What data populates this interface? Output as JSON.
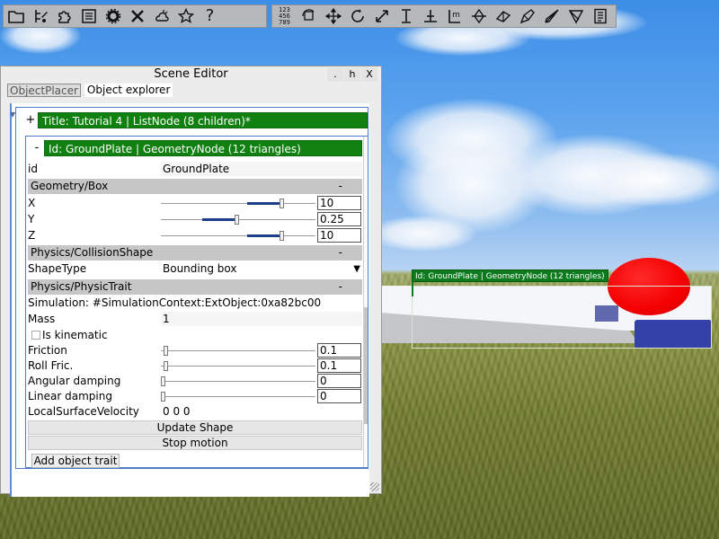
{
  "editor": {
    "title": "Scene Editor",
    "window_buttons": {
      "close_label": ".",
      "hide_label": "h",
      "exit_label": "X"
    },
    "tabs": [
      {
        "label": "ObjectPlacer"
      },
      {
        "label": "Object explorer"
      }
    ],
    "root_node": {
      "toggle": "+",
      "label": "Title: Tutorial 4 | ListNode (8 children)*"
    },
    "child_node": {
      "toggle": "-",
      "label": "Id: GroundPlate | GeometryNode (12 triangles)"
    },
    "id_row": {
      "label": "id",
      "value": "GroundPlate"
    },
    "geometry": {
      "title": "Geometry/Box",
      "collapse": "-",
      "x": {
        "label": "X",
        "value": "10",
        "level": 0.79
      },
      "y": {
        "label": "Y",
        "value": "0.25",
        "level": 0.49
      },
      "z": {
        "label": "Z",
        "value": "10",
        "level": 0.79
      }
    },
    "collision": {
      "title": "Physics/CollisionShape",
      "collapse": "-",
      "shape_label": "ShapeType",
      "shape_value": "Bounding box",
      "dropdown_glyph": "▼"
    },
    "physic_trait": {
      "title": "Physics/PhysicTrait",
      "collapse": "-",
      "simulation": "Simulation: #SimulationContext:ExtObject:0xa82bc00",
      "mass_label": "Mass",
      "mass_value": "1",
      "kinematic_label": "Is kinematic",
      "friction": {
        "label": "Friction",
        "value": "0.1",
        "level": 0.02
      },
      "roll_friction": {
        "label": "Roll Fric.",
        "value": "0.1",
        "level": 0.02
      },
      "angular_damping": {
        "label": "Angular damping",
        "value": "0",
        "level": 0.0
      },
      "linear_damping": {
        "label": "Linear damping",
        "value": "0",
        "level": 0.0
      },
      "velocity_label": "LocalSurfaceVelocity",
      "velocity_value": "0 0 0",
      "update_shape_label": "Update Shape",
      "stop_motion_label": "Stop motion"
    },
    "add_trait_label": "Add object trait"
  },
  "viewport": {
    "selection_label": "Id: GroundPlate | GeometryNode (12 triangles)"
  },
  "toolbar_left": {
    "icons": [
      "folder-icon",
      "tree-edit-icon",
      "puzzle-icon",
      "list-icon",
      "gear-icon",
      "tools-icon",
      "weather-icon",
      "star-icon",
      "help-icon"
    ],
    "help_glyph": "?"
  },
  "toolbar_right": {
    "icons": [
      "numbers-icon",
      "rotate-object-icon",
      "move-icon",
      "rotate-icon",
      "scale-icon",
      "height-icon",
      "anchor-icon",
      "measure-icon",
      "place-icon",
      "aim-icon",
      "edit-shape-icon",
      "flight-icon",
      "transform-icon",
      "notes-icon"
    ],
    "numbers_glyph": "123\n456\n789",
    "measure_glyph": "m"
  },
  "colors": {
    "node_green": "#108110",
    "accent_blue": "#5a8fd8",
    "sphere_red": "#f40000",
    "toolbar_gray": "#b6b9bc"
  }
}
